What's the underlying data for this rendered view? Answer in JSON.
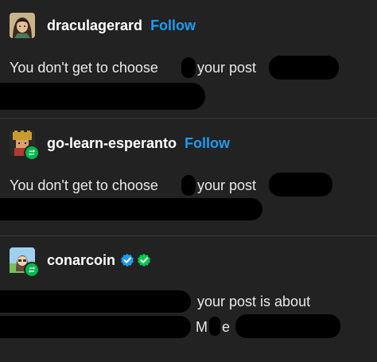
{
  "posts": [
    {
      "username": "draculagerard",
      "follow_label": "Follow",
      "text_part1": "You don't get to choose",
      "text_part2": "your post"
    },
    {
      "username": "go-learn-esperanto",
      "follow_label": "Follow",
      "text_part1": "You don't get to choose",
      "text_part2": "your post"
    },
    {
      "username": "conarcoin",
      "text_line1": "your post is about",
      "text_line2_a": "M",
      "text_line2_b": "e"
    }
  ],
  "colors": {
    "background": "#222222",
    "follow": "#1e9cf0",
    "reblog_badge": "#00b84d",
    "verified_blue": "#1e9cf0",
    "verified_green": "#00c853"
  },
  "icons": [
    "reblog-icon",
    "verified-badge-icon",
    "verified-green-badge-icon"
  ]
}
